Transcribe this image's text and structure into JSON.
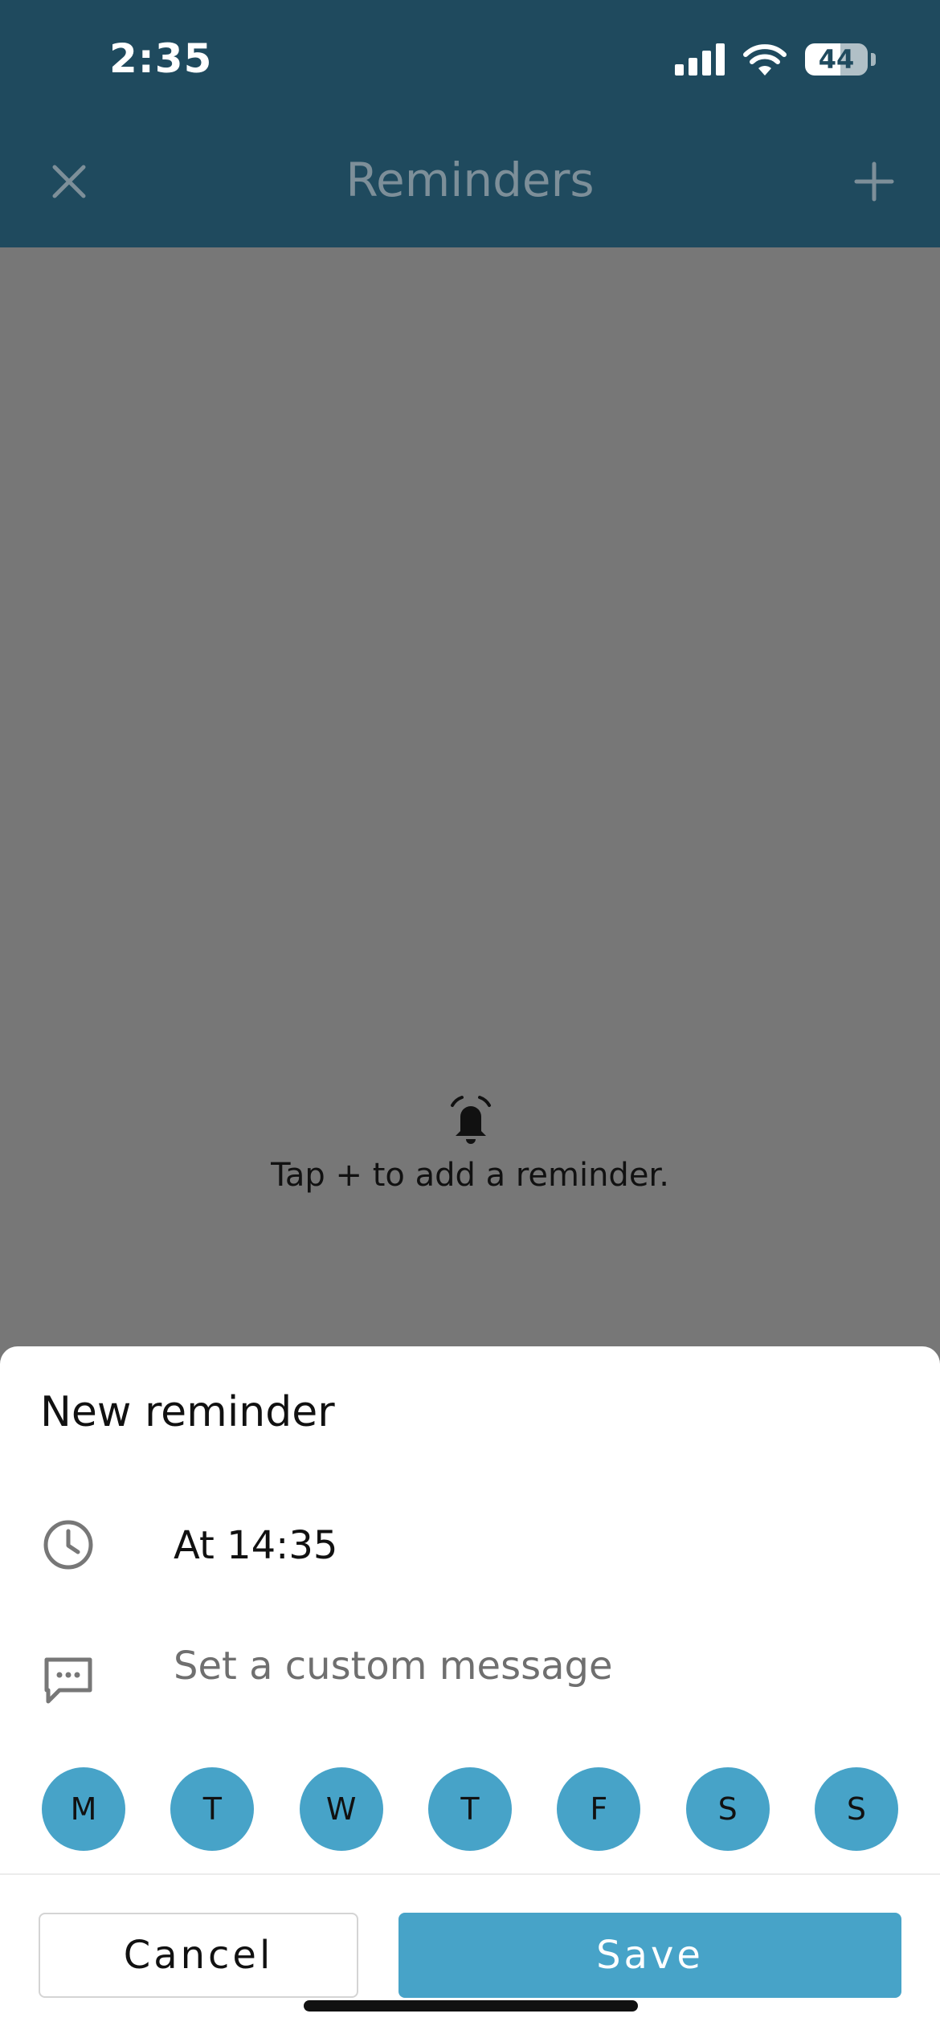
{
  "status_bar": {
    "time": "2:35",
    "battery": "44",
    "battery_level_percent": 44
  },
  "nav": {
    "title": "Reminders",
    "close_icon": "close-icon",
    "add_icon": "plus-icon"
  },
  "empty_state": {
    "icon": "alarm-bell-icon",
    "text": "Tap + to add a reminder."
  },
  "sheet": {
    "title": "New reminder",
    "time_icon": "clock-icon",
    "time_text": "At 14:35",
    "message_icon": "message-icon",
    "message_placeholder": "Set a custom message",
    "message_value": "",
    "days": [
      "M",
      "T",
      "W",
      "T",
      "F",
      "S",
      "S"
    ],
    "cancel_label": "Cancel",
    "save_label": "Save"
  },
  "colors": {
    "header_bg": "#1f4a5e",
    "overlay_bg": "#777777",
    "accent": "#47a3c8"
  }
}
